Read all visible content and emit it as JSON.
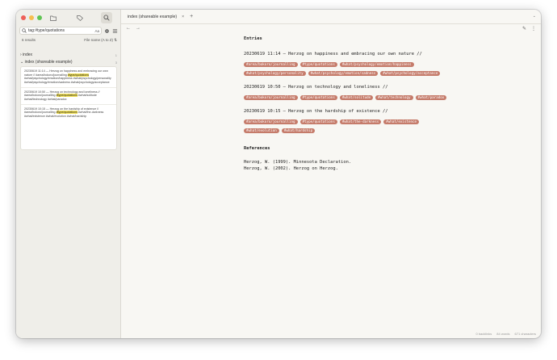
{
  "sidebar": {
    "search_value": "tag:#type/quotations",
    "match_case_label": "Aa",
    "results_count": "6 results",
    "sort_label": "File name (A to Z)",
    "groups": [
      {
        "label": "index",
        "count": "1"
      },
      {
        "label": "index (shareable example)",
        "count": "3"
      }
    ],
    "results": [
      {
        "pre": "20230619 11:14 — Herzog on happiness and embracing our own nature // #area/bokoro/journalling ",
        "hl": "#type/quotations",
        "post": " #what/psychology/emotion/happiness #what/psychology/personality #what/psychology/emotion/sadness #what/psychology/acceptance"
      },
      {
        "pre": "20230619 10:50 — Herzog on technology and loneliness // #area/bokoro/journalling ",
        "hl": "#type/quotations",
        "post": " #what/solitude #what/technology #what/paradox"
      },
      {
        "pre": "20230619 10:15 — Herzog on the hardship of existence // #area/bokoro/journalling ",
        "hl": "#type/quotations",
        "post": " #what/the-darkness #what/existence #what/evolution #what/hardship"
      }
    ]
  },
  "tabbar": {
    "tab_title": "index (shareable example)",
    "close": "×",
    "plus": "+",
    "menu": "⌄"
  },
  "nav": {
    "back": "←",
    "forward": "→",
    "edit": "✎",
    "more": "⋮"
  },
  "document": {
    "entries_heading": "Entries",
    "entries": [
      {
        "title": "20230619 11:14 — Herzog on happiness and embracing our own nature //",
        "tags": [
          "#area/bokoro/journalling",
          "#type/quotations",
          "#what/psychology/emotion/happiness",
          "#what/psychology/personality",
          "#what/psychology/emotion/sadness",
          "#what/psychology/acceptance"
        ]
      },
      {
        "title": "20230619 10:50 — Herzog on technology and loneliness //",
        "tags": [
          "#area/bokoro/journalling",
          "#type/quotations",
          "#what/solitude",
          "#what/technology",
          "#what/paradox"
        ]
      },
      {
        "title": "20230619 10:15 — Herzog on the hardship of existence //",
        "tags": [
          "#area/bokoro/journalling",
          "#type/quotations",
          "#what/the-darkness",
          "#what/existence",
          "#what/evolution",
          "#what/hardship"
        ]
      }
    ],
    "references_heading": "References",
    "references": [
      "Herzog, W. (1999). Minnesota Declaration.",
      "Herzog, W. (2002). Herzog on Herzog."
    ]
  },
  "status": {
    "backlinks": "0 backlinks",
    "words": "84 words",
    "characters": "671 characters"
  },
  "colors": {
    "tag_bg": "#c57b6a",
    "highlight": "#f4e35a"
  }
}
